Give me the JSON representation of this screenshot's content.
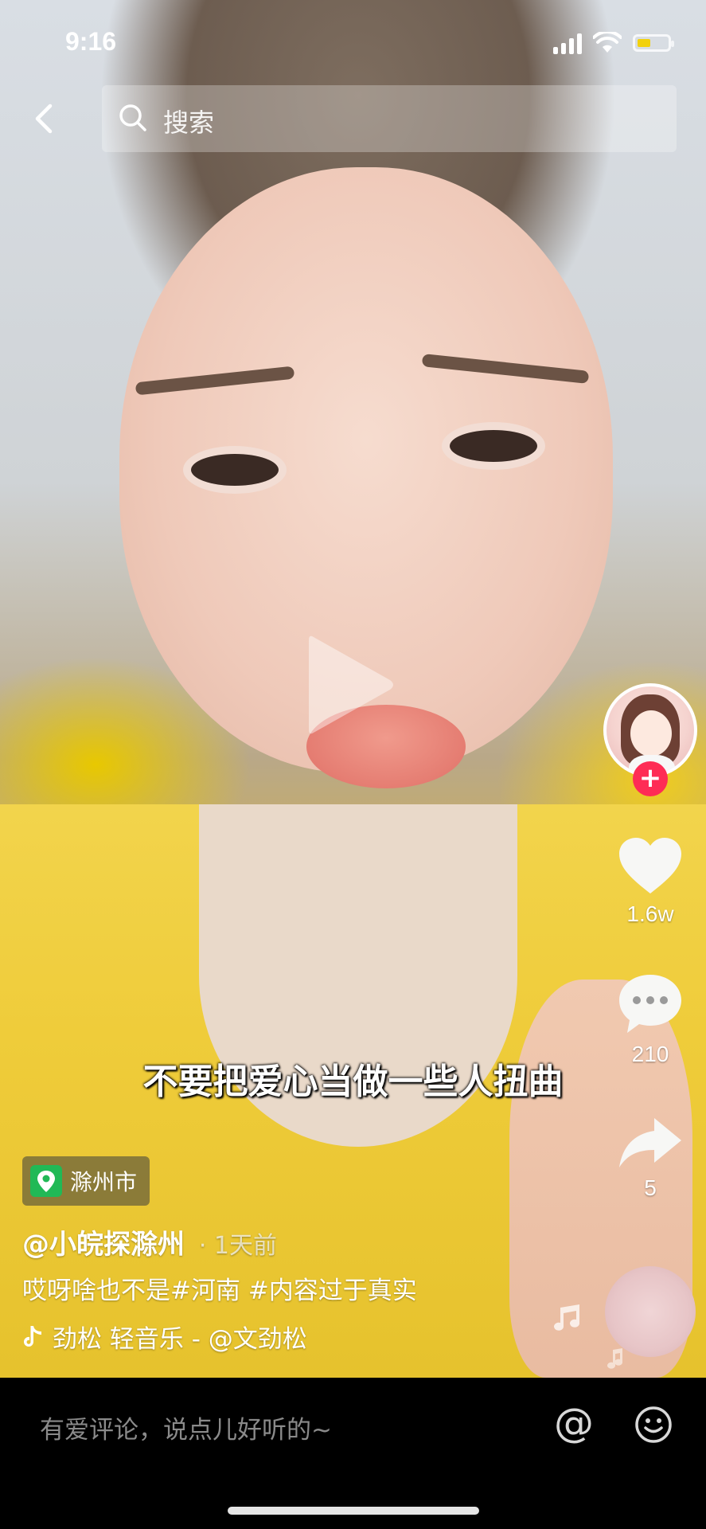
{
  "status_bar": {
    "time": "9:16"
  },
  "search": {
    "placeholder": "搜索"
  },
  "video": {
    "subtitle": "不要把爱心当做一些人扭曲"
  },
  "sidebar": {
    "likes": "1.6w",
    "comments": "210",
    "shares": "5"
  },
  "post": {
    "location": "滁州市",
    "author": "@小皖探滁州",
    "time_ago": "· 1天前",
    "caption": "哎呀啥也不是#河南 #内容过于真实",
    "music": "劲松    轻音乐 - @文劲松"
  },
  "comment_bar": {
    "placeholder": "有爱评论，说点儿好听的~",
    "at_symbol": "@"
  },
  "colors": {
    "follow_red": "#fe2c55",
    "location_green": "#21b956",
    "battery_yellow": "#f2d10d"
  }
}
